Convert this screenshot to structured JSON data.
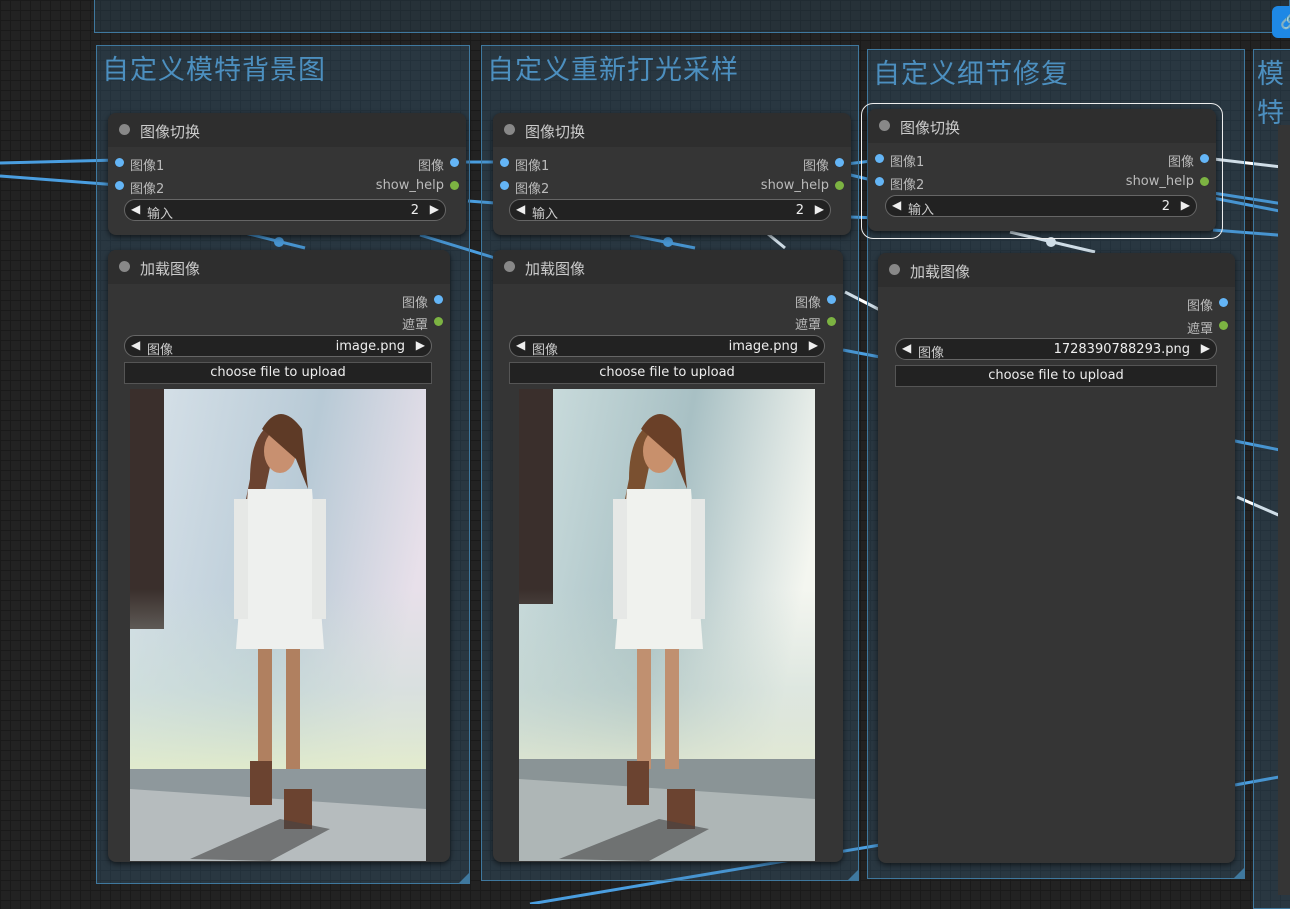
{
  "groups": [
    {
      "title": "自定义模特背景图"
    },
    {
      "title": "自定义重新打光采样"
    },
    {
      "title": "自定义细节修复"
    },
    {
      "title": "模特"
    }
  ],
  "switch_nodes": [
    {
      "title": "图像切换",
      "in1": "图像1",
      "in2": "图像2",
      "out1": "图像",
      "out2": "show_help",
      "widget_label": "输入",
      "widget_value": "2"
    },
    {
      "title": "图像切换",
      "in1": "图像1",
      "in2": "图像2",
      "out1": "图像",
      "out2": "show_help",
      "widget_label": "输入",
      "widget_value": "2"
    },
    {
      "title": "图像切换",
      "in1": "图像1",
      "in2": "图像2",
      "out1": "图像",
      "out2": "show_help",
      "widget_label": "输入",
      "widget_value": "2"
    }
  ],
  "load_nodes": [
    {
      "title": "加载图像",
      "out1": "图像",
      "out2": "遮罩",
      "widget_label": "图像",
      "widget_value": "image.png",
      "upload_label": "choose file to upload"
    },
    {
      "title": "加载图像",
      "out1": "图像",
      "out2": "遮罩",
      "widget_label": "图像",
      "widget_value": "image.png",
      "upload_label": "choose file to upload"
    },
    {
      "title": "加载图像",
      "out1": "图像",
      "out2": "遮罩",
      "widget_label": "图像",
      "widget_value": "1728390788293.png",
      "upload_label": "choose file to upload"
    }
  ],
  "colors": {
    "group_border": "#3f789e",
    "pin_image": "#64b5f6",
    "pin_help": "#7cb342",
    "wire": "#4a9ee0"
  },
  "badge_icon": "link-icon"
}
